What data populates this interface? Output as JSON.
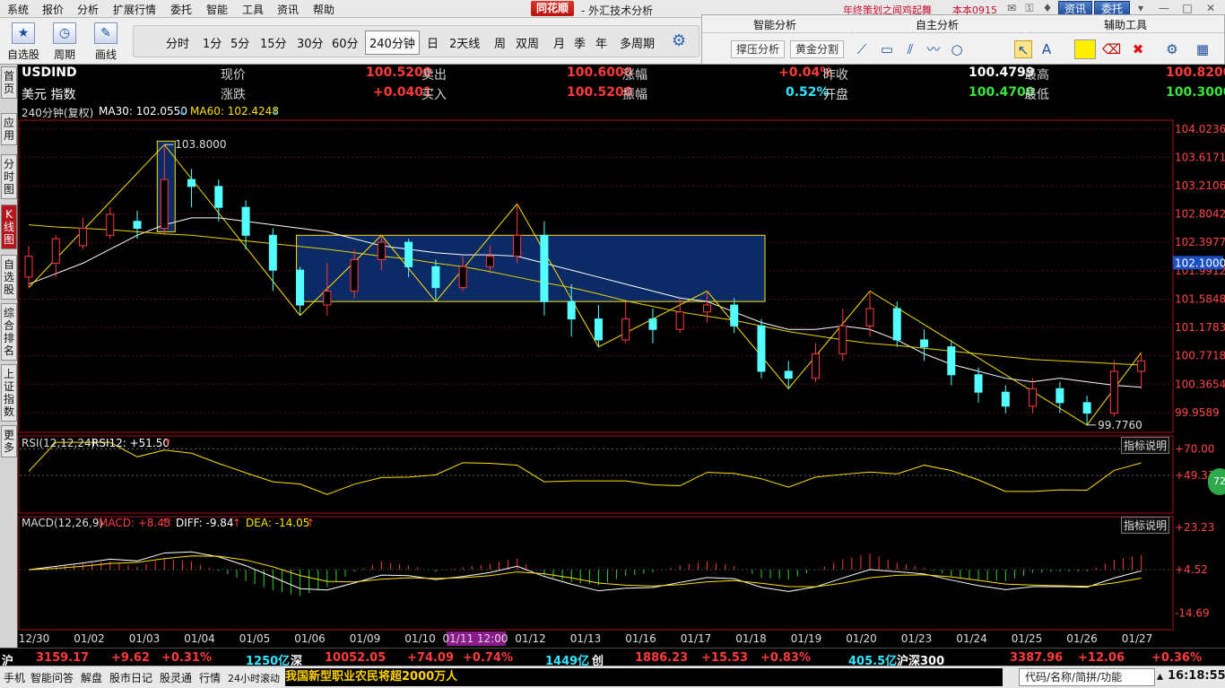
{
  "menubar": {
    "items": [
      "系统",
      "报价",
      "分析",
      "扩展行情",
      "委托",
      "智能",
      "工具",
      "资讯",
      "帮助"
    ],
    "brand": "同花顺",
    "title": "- 外汇技术分析",
    "promo": "年终策划之闻鸡起舞",
    "version": "本本0915",
    "btn_news": "资讯",
    "btn_trade": "委托"
  },
  "toolbar": {
    "self_select": "自选股",
    "cycle": "周期",
    "draw_line": "画线",
    "periods": [
      "分时",
      "1分",
      "5分",
      "15分",
      "30分",
      "60分",
      "240分钟",
      "日",
      "2天线",
      "周",
      "双周",
      "月",
      "季",
      "年",
      "多周期"
    ],
    "active_period": "240分钟"
  },
  "analysis": {
    "smart": "智能分析",
    "self": "自主分析",
    "aux": "辅助工具",
    "btn_pressure": "撑压分析",
    "btn_golden": "黄金分割"
  },
  "left_tabs": [
    {
      "label": "首页",
      "active": false
    },
    {
      "label": "应用",
      "active": false
    },
    {
      "label": "分时图",
      "active": false
    },
    {
      "label": "K线图",
      "active": true
    },
    {
      "label": "自选股",
      "active": false
    },
    {
      "label": "综合排名",
      "active": false
    },
    {
      "label": "上证指数",
      "active": false
    },
    {
      "label": "更多",
      "active": false
    }
  ],
  "quote": {
    "symbol": "USDIND",
    "name": "美元 指数",
    "current_label": "现价",
    "current": "100.5200",
    "change_label": "涨跌",
    "change": "+0.0401",
    "sell_label": "卖出",
    "sell": "100.6000",
    "buy_label": "买入",
    "buy": "100.5200",
    "pct_label": "涨幅",
    "pct": "+0.04%",
    "amp_label": "振幅",
    "amp": "0.52%",
    "prev_label": "昨收",
    "prev": "100.4799",
    "open_label": "开盘",
    "open": "100.4700",
    "high_label": "最高",
    "high": "100.8200",
    "low_label": "最低",
    "low": "100.3000"
  },
  "ma_line": {
    "period": "240分钟(复权)",
    "ma30": "MA30: 102.0550",
    "ma60": "MA60: 102.4248"
  },
  "rsi": {
    "header": "RSI(12,12,24)",
    "value": "RSI12: +51.50",
    "button": "指标说明",
    "ticks": [
      "+70.00",
      "+49.33"
    ],
    "badge": "72"
  },
  "macd": {
    "header": "MACD(12,26,9)",
    "macd": "MACD: +8.43",
    "diff": "DIFF: -9.84",
    "dea": "DEA: -14.05",
    "button": "指标说明",
    "ticks": [
      "+23.23",
      "+4.52",
      "-14.69"
    ]
  },
  "chart_data": {
    "type": "candlestick",
    "y_axis_ticks": [
      "104.0236",
      "103.6171",
      "103.2106",
      "102.8042",
      "102.3977",
      "101.9912",
      "101.5848",
      "101.1783",
      "100.7718",
      "100.3654",
      "99.9589"
    ],
    "y_range": [
      99.7,
      104.15
    ],
    "current_price_tag": "102.1000",
    "x_labels": [
      "12/30",
      "01/02",
      "01/03",
      "01/04",
      "01/05",
      "01/06",
      "01/09",
      "01/10",
      "01/11 12:00",
      "01/12",
      "01/13",
      "01/16",
      "01/17",
      "01/18",
      "01/19",
      "01/20",
      "01/23",
      "01/24",
      "01/25",
      "01/26",
      "01/27"
    ],
    "annotations": {
      "max": "103.8000",
      "min": "99.7760"
    },
    "ma30": [
      101.8,
      101.95,
      102.1,
      102.3,
      102.5,
      102.65,
      102.75,
      102.75,
      102.7,
      102.65,
      102.6,
      102.55,
      102.45,
      102.35,
      102.3,
      102.25,
      102.22,
      102.22,
      102.2,
      102.1,
      102.0,
      101.9,
      101.8,
      101.7,
      101.6,
      101.55,
      101.4,
      101.25,
      101.15,
      101.15,
      101.2,
      101.15,
      101.0,
      100.8,
      100.65,
      100.55,
      100.45,
      100.4,
      100.45,
      100.4,
      100.35,
      100.32
    ],
    "ma60": [
      102.65,
      102.62,
      102.6,
      102.58,
      102.55,
      102.52,
      102.5,
      102.46,
      102.42,
      102.38,
      102.34,
      102.3,
      102.25,
      102.2,
      102.16,
      102.1,
      102.05,
      101.98,
      101.9,
      101.82,
      101.75,
      101.66,
      101.56,
      101.48,
      101.4,
      101.34,
      101.28,
      101.2,
      101.12,
      101.06,
      101.0,
      100.95,
      100.92,
      100.88,
      100.84,
      100.8,
      100.76,
      100.72,
      100.7,
      100.68,
      100.66,
      100.64
    ],
    "candles": [
      [
        101.9,
        102.2,
        102.35,
        101.75
      ],
      [
        102.1,
        102.45,
        102.5,
        101.9
      ],
      [
        102.35,
        102.6,
        102.75,
        102.3
      ],
      [
        102.5,
        102.8,
        102.9,
        102.45
      ],
      [
        102.7,
        102.6,
        102.85,
        102.45
      ],
      [
        102.6,
        103.3,
        103.8,
        102.5
      ],
      [
        103.3,
        103.2,
        103.45,
        102.9
      ],
      [
        103.2,
        102.9,
        103.3,
        102.7
      ],
      [
        102.9,
        102.5,
        103.0,
        102.3
      ],
      [
        102.5,
        102.0,
        102.6,
        101.7
      ],
      [
        102.0,
        101.5,
        102.05,
        101.35
      ],
      [
        101.5,
        101.7,
        102.1,
        101.35
      ],
      [
        101.7,
        102.15,
        102.3,
        101.6
      ],
      [
        102.15,
        102.4,
        102.5,
        102.0
      ],
      [
        102.4,
        102.05,
        102.45,
        101.9
      ],
      [
        102.05,
        101.75,
        102.15,
        101.55
      ],
      [
        101.75,
        102.05,
        102.2,
        101.7
      ],
      [
        102.05,
        102.2,
        102.35,
        101.95
      ],
      [
        102.2,
        102.5,
        102.95,
        102.1
      ],
      [
        102.5,
        101.55,
        102.7,
        101.35
      ],
      [
        101.55,
        101.3,
        101.8,
        101.05
      ],
      [
        101.3,
        101.0,
        101.5,
        100.9
      ],
      [
        101.0,
        101.3,
        101.55,
        100.95
      ],
      [
        101.3,
        101.15,
        101.45,
        100.95
      ],
      [
        101.15,
        101.4,
        101.6,
        101.1
      ],
      [
        101.4,
        101.5,
        101.7,
        101.25
      ],
      [
        101.5,
        101.2,
        101.6,
        101.1
      ],
      [
        101.2,
        100.55,
        101.3,
        100.45
      ],
      [
        100.55,
        100.45,
        100.7,
        100.3
      ],
      [
        100.45,
        100.8,
        100.95,
        100.4
      ],
      [
        100.8,
        101.2,
        101.45,
        100.7
      ],
      [
        101.2,
        101.45,
        101.7,
        101.05
      ],
      [
        101.45,
        101.0,
        101.55,
        100.9
      ],
      [
        101.0,
        100.9,
        101.15,
        100.7
      ],
      [
        100.9,
        100.5,
        101.0,
        100.35
      ],
      [
        100.5,
        100.25,
        100.6,
        100.1
      ],
      [
        100.25,
        100.05,
        100.35,
        99.95
      ],
      [
        100.05,
        100.3,
        100.45,
        99.95
      ],
      [
        100.3,
        100.1,
        100.4,
        99.95
      ],
      [
        100.1,
        99.95,
        100.2,
        99.78
      ],
      [
        99.95,
        100.55,
        100.7,
        99.9
      ],
      [
        100.55,
        100.7,
        100.82,
        100.3
      ]
    ]
  },
  "ticker": {
    "sh_label": "沪",
    "sh_index": "3159.17",
    "sh_change": "+9.62",
    "sh_pct": "+0.31%",
    "sh_amount": "1250亿",
    "sz_label": "深",
    "sz_index": "10052.05",
    "sz_change": "+74.09",
    "sz_pct": "+0.74%",
    "cy_amount": "1449亿",
    "cy_label": "创",
    "cy_index": "1886.23",
    "cy_change": "+15.53",
    "cy_pct": "+0.83%",
    "hs_amount": "405.5亿",
    "hs_label": "沪深300",
    "hs_index": "3387.96",
    "hs_change": "+12.06",
    "hs_pct": "+0.36%"
  },
  "statusbar": {
    "items": [
      "手机",
      "智能问答",
      "解盘",
      "股市日记",
      "股灵通",
      "行情",
      "24小时滚动"
    ],
    "news": "我国新型职业农民将超2000万人",
    "search_placeholder": "代码/名称/简拼/功能",
    "clock": "16:18:55"
  }
}
